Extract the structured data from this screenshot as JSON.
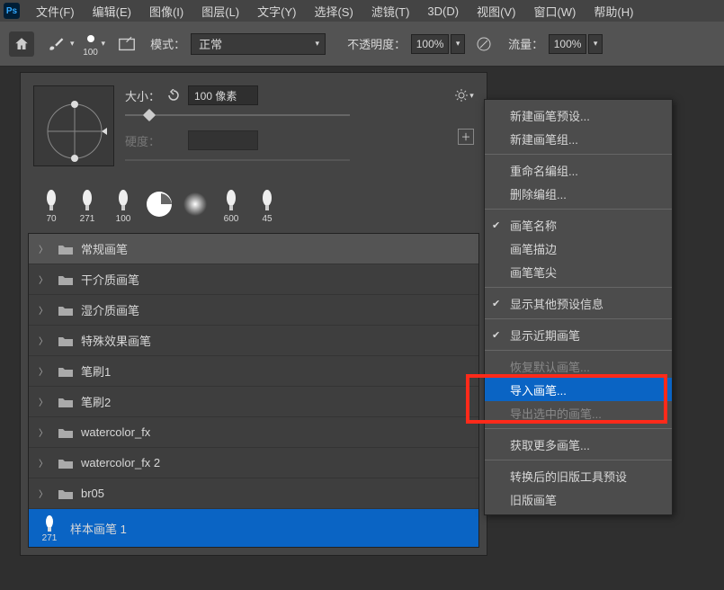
{
  "menubar": {
    "items": [
      "文件(F)",
      "编辑(E)",
      "图像(I)",
      "图层(L)",
      "文字(Y)",
      "选择(S)",
      "滤镜(T)",
      "3D(D)",
      "视图(V)",
      "窗口(W)",
      "帮助(H)"
    ]
  },
  "optionbar": {
    "brush_size_num": "100",
    "mode_label": "模式：",
    "mode_value": "正常",
    "opacity_label": "不透明度：",
    "opacity_value": "100%",
    "flow_label": "流量：",
    "flow_value": "100%"
  },
  "panel": {
    "size_label": "大小：",
    "size_value": "100 像素",
    "hard_label": "硬度：",
    "recent": [
      {
        "num": "70"
      },
      {
        "num": "271"
      },
      {
        "num": "100"
      },
      {
        "num": ""
      },
      {
        "num": ""
      },
      {
        "num": "600"
      },
      {
        "num": "45"
      }
    ],
    "folders": [
      {
        "name": "常规画笔",
        "selected": true
      },
      {
        "name": "干介质画笔"
      },
      {
        "name": "湿介质画笔"
      },
      {
        "name": "特殊效果画笔"
      },
      {
        "name": "笔刷1"
      },
      {
        "name": "笔刷2"
      },
      {
        "name": "watercolor_fx"
      },
      {
        "name": "watercolor_fx 2"
      },
      {
        "name": "br05"
      }
    ],
    "sample_num": "271",
    "sample_name": "样本画笔 1"
  },
  "context_menu": {
    "items": [
      {
        "t": "item",
        "label": "新建画笔预设..."
      },
      {
        "t": "item",
        "label": "新建画笔组..."
      },
      {
        "t": "sep"
      },
      {
        "t": "item",
        "label": "重命名编组..."
      },
      {
        "t": "item",
        "label": "删除编组..."
      },
      {
        "t": "sep"
      },
      {
        "t": "item",
        "label": "画笔名称",
        "check": true
      },
      {
        "t": "item",
        "label": "画笔描边"
      },
      {
        "t": "item",
        "label": "画笔笔尖"
      },
      {
        "t": "sep"
      },
      {
        "t": "item",
        "label": "显示其他预设信息",
        "check": true
      },
      {
        "t": "sep"
      },
      {
        "t": "item",
        "label": "显示近期画笔",
        "check": true
      },
      {
        "t": "sep"
      },
      {
        "t": "item",
        "label": "恢复默认画笔...",
        "disabled": true
      },
      {
        "t": "item",
        "label": "导入画笔...",
        "highlighted": true
      },
      {
        "t": "item",
        "label": "导出选中的画笔...",
        "disabled": true
      },
      {
        "t": "sep"
      },
      {
        "t": "item",
        "label": "获取更多画笔..."
      },
      {
        "t": "sep"
      },
      {
        "t": "item",
        "label": "转换后的旧版工具预设"
      },
      {
        "t": "item",
        "label": "旧版画笔"
      }
    ]
  }
}
